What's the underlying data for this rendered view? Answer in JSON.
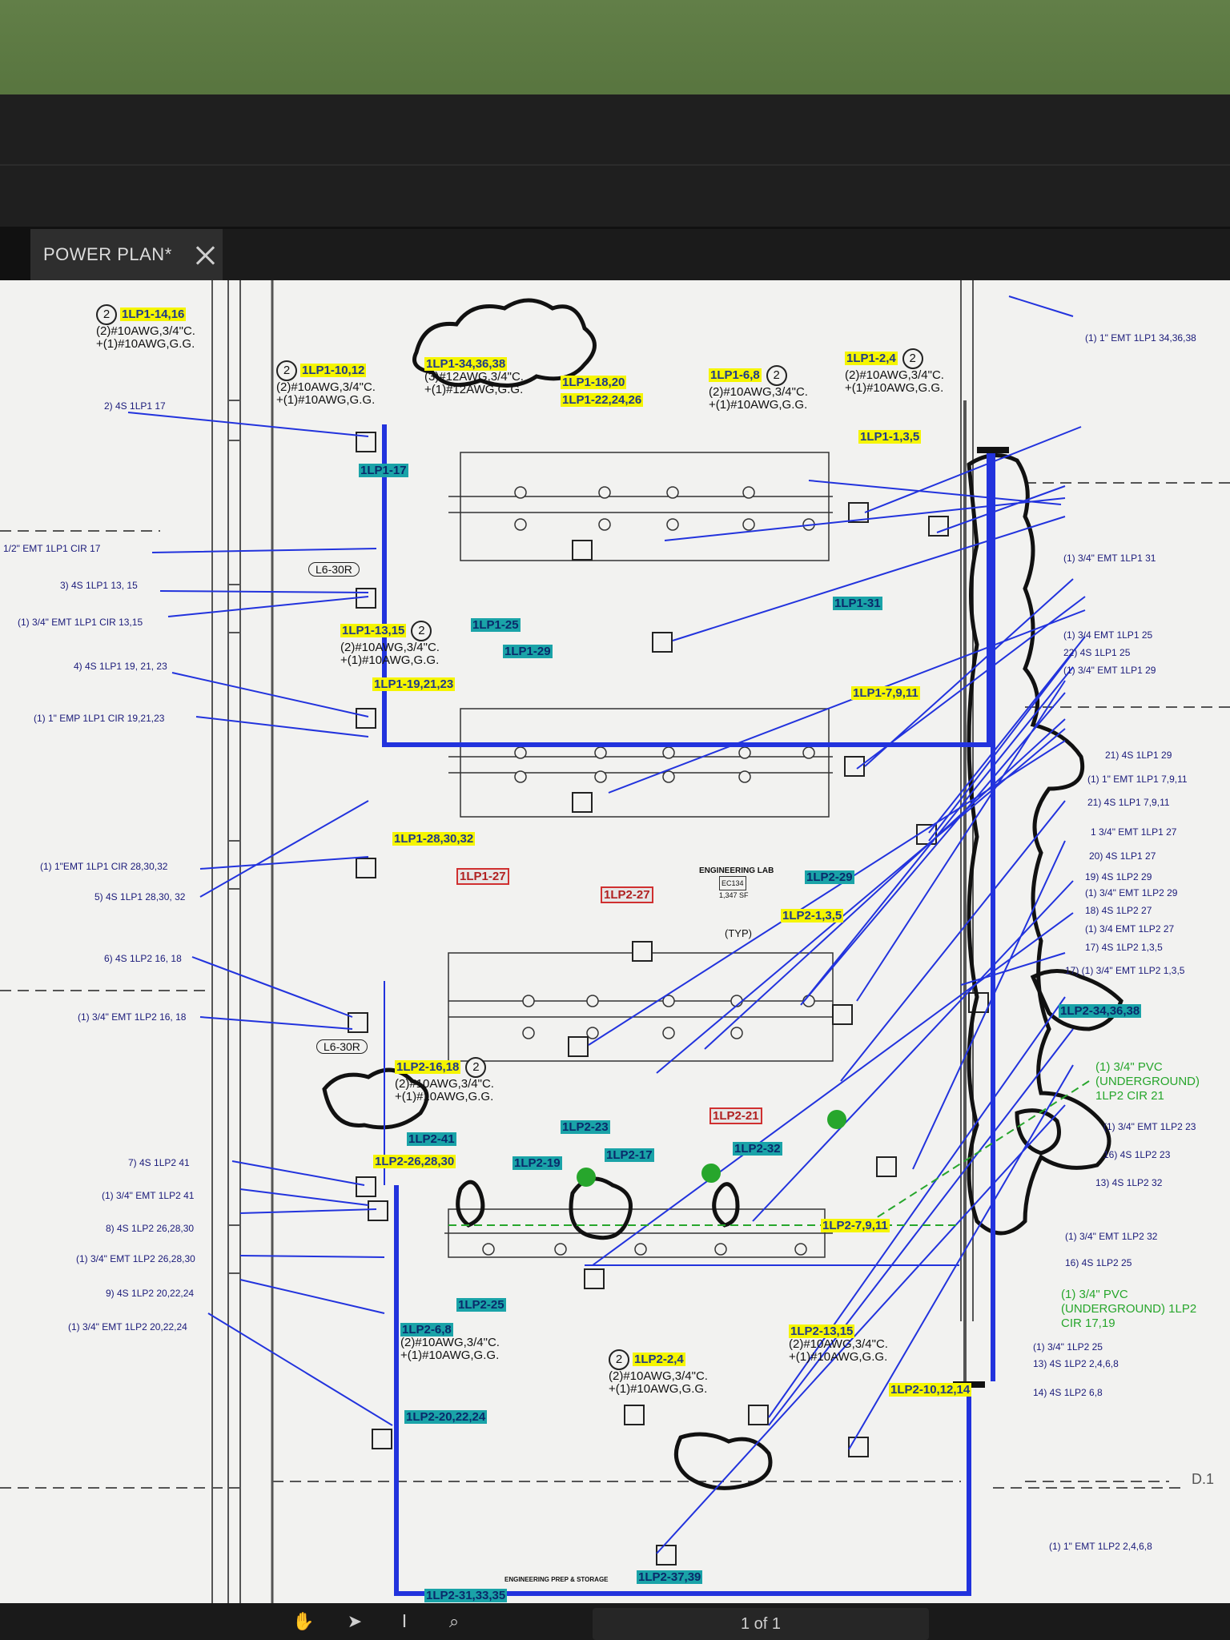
{
  "tab": {
    "title": "POWER PLAN*"
  },
  "sheet_tag": "D.1",
  "room_label": "ENGINEERING LAB",
  "room_number": "EC134",
  "room_area": "1,347 SF",
  "storage_label": "ENGINEERING PREP & STORAGE",
  "left_notes": [
    "2) 4S 1LP1 17",
    "1/2\" EMT 1LP1 CIR 17",
    "3) 4S 1LP1 13, 15",
    "(1) 3/4\" EMT 1LP1 CIR 13,15",
    "4) 4S 1LP1 19, 21, 23",
    "(1) 1\" EMP 1LP1 CIR 19,21,23",
    "(1) 1\"EMT 1LP1 CIR 28,30,32",
    "5) 4S 1LP1 28,30, 32",
    "6) 4S 1LP2 16, 18",
    "(1) 3/4\" EMT 1LP2 16, 18",
    "7) 4S 1LP2 41",
    "(1) 3/4\" EMT 1LP2 41",
    "8) 4S 1LP2 26,28,30",
    "(1) 3/4\" EMT 1LP2 26,28,30",
    "9) 4S 1LP2 20,22,24",
    "(1) 3/4\" EMT 1LP2 20,22,24"
  ],
  "right_notes": [
    "(1) 1\" EMT 1LP1 34,36,38",
    "(1) 3/4\" EMT 1LP1 31",
    "(1) 3/4 EMT 1LP1 25",
    "22) 4S 1LP1 25",
    "(1) 3/4\" EMT 1LP1 29",
    "21) 4S 1LP1 29",
    "(1) 1\" EMT 1LP1 7,9,11",
    "21) 4S 1LP1 7,9,11",
    "1 3/4\" EMT 1LP1 27",
    "20) 4S 1LP1 27",
    "19) 4S 1LP2 29",
    "(1) 3/4\" EMT 1LP2 29",
    "18) 4S 1LP2 27",
    "(1) 3/4 EMT 1LP2 27",
    "17) 4S 1LP2 1,3,5",
    "17) (1) 3/4\" EMT 1LP2 1,3,5",
    "(1) 3/4\" EMT 1LP2 23",
    "16) 4S 1LP2 23",
    "13) 4S 1LP2 32",
    "(1) 3/4\" EMT 1LP2 32",
    "16) 4S 1LP2 25",
    "(1) 3/4\" 1LP2 25",
    "13) 4S 1LP2 2,4,6,8",
    "14) 4S 1LP2 6,8",
    "(1) 1\" EMT 1LP2 2,4,6,8"
  ],
  "green_notes": [
    "(1) 3/4\" PVC (UNDERGROUND) 1LP2 CIR 21",
    "(1) 3/4\" PVC (UNDERGROUND) 1LP2 CIR 17,19"
  ],
  "circuit_tags": {
    "t1": "1LP1-14,16",
    "t2": "1LP1-10,12",
    "t3": "1LP1-34,36,38",
    "t4": "1LP1-18,20",
    "t5": "1LP1-22,24,26",
    "t6": "1LP1-6,8",
    "t7": "1LP1-2,4",
    "t8": "1LP1-1,3,5",
    "t9": "1LP1-17",
    "t10": "1LP1-31",
    "t11": "1LP1-13,15",
    "t12": "1LP1-25",
    "t13": "1LP1-29",
    "t14": "1LP1-19,21,23",
    "t15": "1LP1-7,9,11",
    "t16": "1LP1-28,30,32",
    "t17": "1LP1-27",
    "t18": "1LP2-27",
    "t19": "1LP2-29",
    "t20": "1LP2-1,3,5",
    "t21": "1LP2-34,36,38",
    "t22": "1LP2-16,18",
    "t23": "1LP2-23",
    "t24": "1LP2-21",
    "t25": "1LP2-41",
    "t26": "1LP2-26,28,30",
    "t27": "1LP2-19",
    "t28": "1LP2-17",
    "t29": "1LP2-32",
    "t30": "1LP2-7,9,11",
    "t31": "1LP2-25",
    "t32": "1LP2-6,8",
    "t33": "1LP2-2,4",
    "t34": "1LP2-13,15",
    "t35": "1LP2-10,12,14",
    "t36": "1LP2-20,22,24",
    "t37": "1LP2-37,39",
    "t38": "1LP2-31,33,35"
  },
  "wire_notes": {
    "w1": "(2)#10AWG,3/4\"C.",
    "w2": "+(1)#10AWG,G.G.",
    "w3": "(3)#12AWG,3/4\"C.",
    "w4": "+(1)#12AWG,G.G."
  },
  "devices": {
    "receptacle": "L6-30R",
    "tip": "(TYP)"
  },
  "pager": {
    "label": "1 of 1"
  },
  "colors": {
    "circuit_line": "#2233dd",
    "cloud": "#111111",
    "highlight_yellow": "#f5f500",
    "highlight_cyan": "#1aa3a8",
    "underground": "#27a62c"
  }
}
